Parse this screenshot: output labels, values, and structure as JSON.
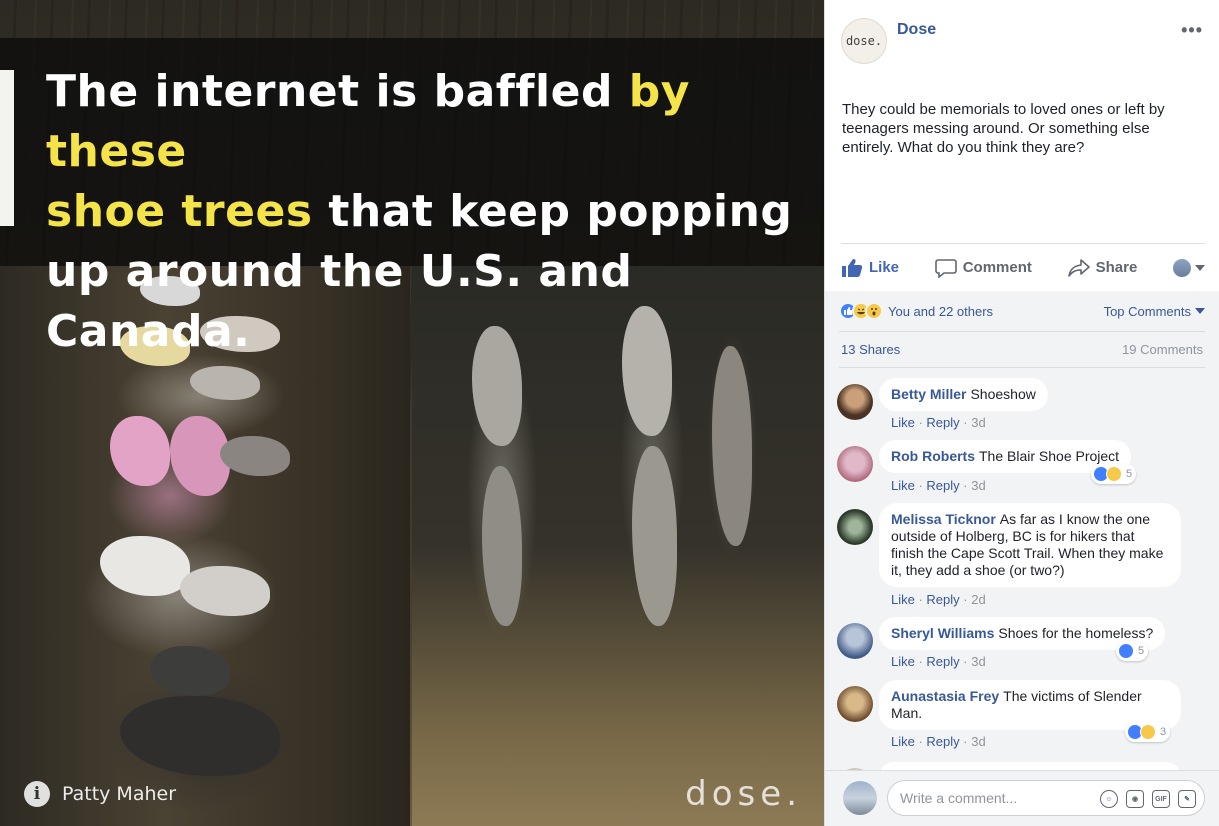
{
  "photo": {
    "headline_part1": "The internet is baffled ",
    "headline_highlight1": "by these",
    "headline_highlight2": "shoe trees",
    "headline_part2": " that keep popping up around the U.S. and Canada.",
    "credit_icon": "i",
    "credit_name": "Patty Maher",
    "watermark": "dose."
  },
  "post": {
    "avatar_text": "dose.",
    "page_name": "Dose",
    "more_icon": "•••",
    "text": "They could be memorials to loved ones or left by teenagers messing around. Or something else entirely. What do you think they are?"
  },
  "actions": {
    "like": "Like",
    "comment": "Comment",
    "share": "Share"
  },
  "reactions": {
    "summary": "You and 22 others",
    "sort_label": "Top Comments",
    "shares": "13 Shares",
    "comments": "19 Comments"
  },
  "comments": [
    {
      "author": "Betty Miller",
      "text": "Shoeshow",
      "like": "Like",
      "reply": "Reply",
      "time": "3d",
      "reaction_count": ""
    },
    {
      "author": "Rob Roberts",
      "text": "The Blair Shoe Project",
      "like": "Like",
      "reply": "Reply",
      "time": "3d",
      "reaction_count": "5"
    },
    {
      "author": "Melissa Ticknor",
      "text": "As far as I know the one outside of Holberg, BC is for hikers that finish the Cape Scott Trail. When they make it, they add a shoe (or two?)",
      "like": "Like",
      "reply": "Reply",
      "time": "2d",
      "reaction_count": ""
    },
    {
      "author": "Sheryl Williams",
      "text": "Shoes for the homeless?",
      "like": "Like",
      "reply": "Reply",
      "time": "3d",
      "reaction_count": "5"
    },
    {
      "author": "Aunastasia Frey",
      "text": "The victims of Slender Man.",
      "like": "Like",
      "reply": "Reply",
      "time": "3d",
      "reaction_count": "3"
    }
  ],
  "composer": {
    "placeholder": "Write a comment...",
    "gif_label": "GIF"
  },
  "colors": {
    "link_blue": "#385898",
    "like_blue": "#4267b2",
    "highlight_yellow": "#f5e34a",
    "panel_gray": "#f2f3f5"
  }
}
